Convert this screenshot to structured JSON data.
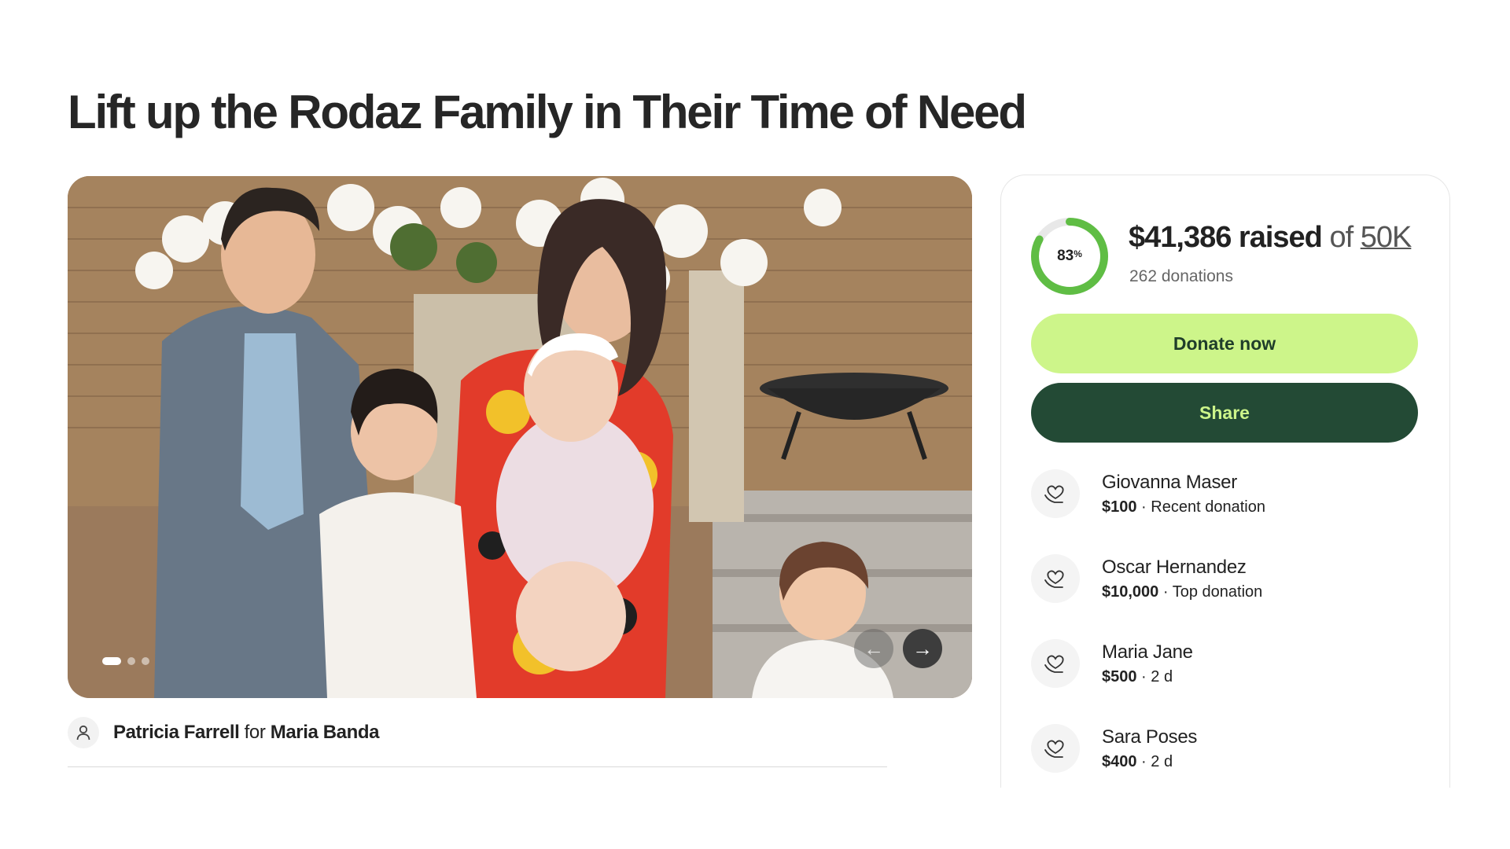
{
  "page": {
    "title": "Lift up the Rodaz Family in Their Time of Need"
  },
  "organizer": {
    "name": "Patricia Farrell",
    "connector": "for",
    "beneficiary": "Maria Banda"
  },
  "gallery": {
    "slide_count": 3,
    "active_slide": 1,
    "prev_icon": "arrow-left-icon",
    "next_icon": "arrow-right-icon"
  },
  "fundraiser": {
    "progress_percent": 83,
    "progress_label": "83",
    "progress_suffix": "%",
    "raised_amount": "$41,386 raised",
    "of_text": "of",
    "goal": "50K",
    "donations_count": "262 donations",
    "donate_label": "Donate now",
    "share_label": "Share",
    "colors": {
      "progress": "#5fbd44",
      "progress_track": "#e8e8e8",
      "donate_bg": "#cdf58a",
      "share_bg": "#234a35"
    }
  },
  "donations": [
    {
      "name": "Giovanna Maser",
      "amount": "$100",
      "separator": " · ",
      "note": "Recent donation",
      "icon": "heart-hand-icon"
    },
    {
      "name": "Oscar Hernandez",
      "amount": "$10,000",
      "separator": " · ",
      "note": "Top donation",
      "icon": "heart-hand-icon"
    },
    {
      "name": "Maria Jane",
      "amount": "$500",
      "separator": " · ",
      "note": "2 d",
      "icon": "heart-hand-icon"
    },
    {
      "name": "Sara Poses",
      "amount": "$400",
      "separator": " · ",
      "note": "2 d",
      "icon": "heart-hand-icon"
    }
  ]
}
